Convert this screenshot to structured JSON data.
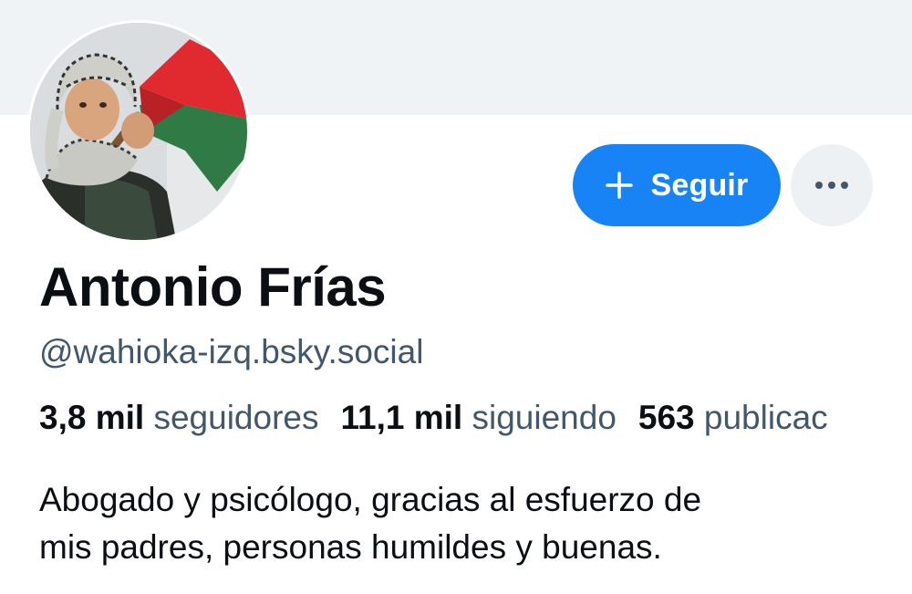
{
  "profile": {
    "avatar_icon": "avatar-photo",
    "display_name": "Antonio Frías",
    "handle": "@wahioka-izq.bsky.social",
    "follow_button_label": "Seguir",
    "follow_icon": "plus-icon",
    "more_icon": "ellipsis-icon",
    "stats": {
      "followers_count": "3,8 mil",
      "followers_label": "seguidores",
      "following_count": "11,1 mil",
      "following_label": "siguiendo",
      "posts_count": "563",
      "posts_label": "publicac"
    },
    "bio_lines": [
      "Abogado y psicólogo, gracias al esfuerzo de",
      "mis padres, personas humildes y buenas."
    ]
  },
  "colors": {
    "banner": "#f0f3f5",
    "accent": "#1883f5",
    "secondary_text": "#42576c",
    "primary_text": "#0b0f14",
    "more_button_bg": "#eef1f4"
  }
}
